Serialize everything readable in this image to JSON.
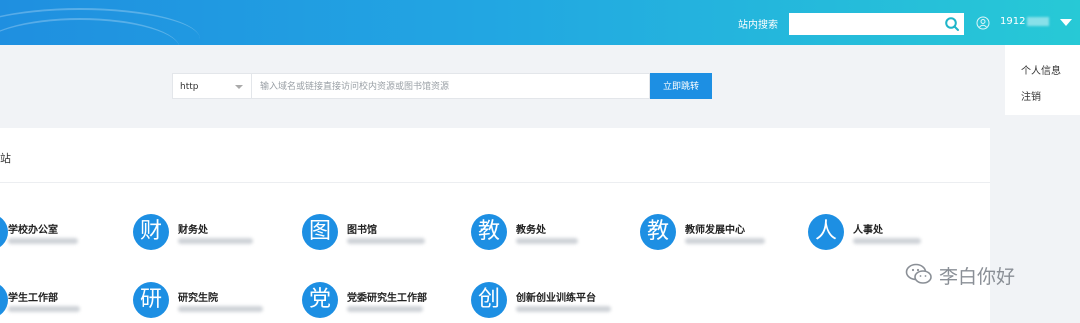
{
  "header": {
    "site_search_label": "站内搜索",
    "search_placeholder": "",
    "username": "1912",
    "colors": {
      "gradient_start": "#1f8fe0",
      "gradient_end": "#27c9d6"
    }
  },
  "user_menu": {
    "items": [
      "个人信息",
      "注销"
    ]
  },
  "url_bar": {
    "protocol": "http",
    "placeholder": "输入域名或链接直接访问校内资源或图书馆资源",
    "jump_label": "立即跳转"
  },
  "panel": {
    "title": "站",
    "sites": [
      {
        "glyph": "",
        "name": "学校办公室"
      },
      {
        "glyph": "财",
        "name": "财务处"
      },
      {
        "glyph": "图",
        "name": "图书馆"
      },
      {
        "glyph": "教",
        "name": "教务处"
      },
      {
        "glyph": "教",
        "name": "教师发展中心"
      },
      {
        "glyph": "人",
        "name": "人事处"
      },
      {
        "glyph": "",
        "name": "学生工作部"
      },
      {
        "glyph": "研",
        "name": "研究生院"
      },
      {
        "glyph": "党",
        "name": "党委研究生工作部"
      },
      {
        "glyph": "创",
        "name": "创新创业训练平台"
      }
    ]
  },
  "watermark": {
    "text": "李白你好",
    "icon": "wechat-icon"
  },
  "icons": {
    "search": "search-icon",
    "user": "user-icon",
    "dropdown": "chevron-down-icon"
  },
  "accent_color": "#1d8fe3"
}
